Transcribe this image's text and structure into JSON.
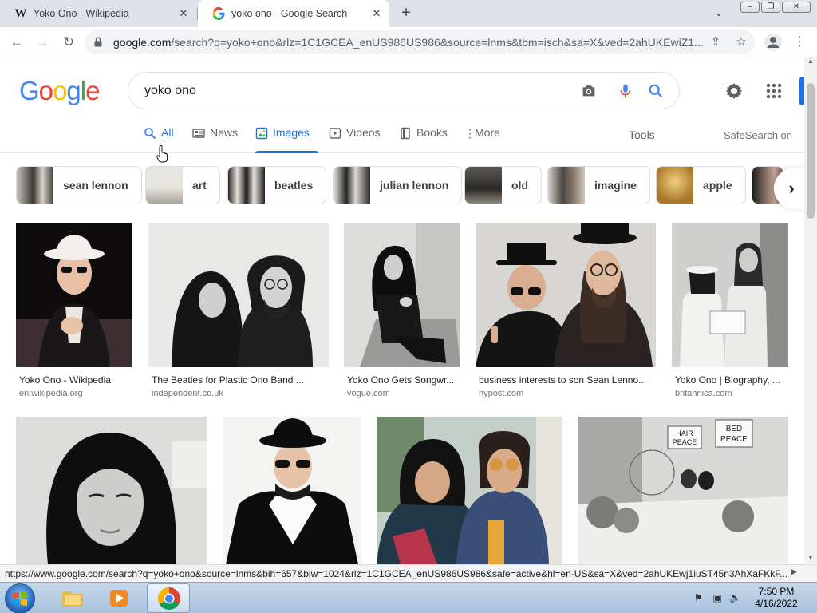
{
  "browser": {
    "tabs": [
      {
        "title": "Yoko Ono - Wikipedia",
        "favicon": "W"
      },
      {
        "title": "yoko ono - Google Search",
        "favicon": "google-g"
      }
    ],
    "url_host": "google.com",
    "url_path": "/search?q=yoko+ono&rlz=1C1GCEA_enUS986US986&source=lnms&tbm=isch&sa=X&ved=2ahUKEwiZ1..."
  },
  "google": {
    "logo": "Google",
    "query": "yoko ono",
    "nav": [
      {
        "label": "All",
        "icon": "search-icon",
        "active": false
      },
      {
        "label": "News",
        "icon": "news-icon",
        "active": false
      },
      {
        "label": "Images",
        "icon": "image-icon",
        "active": true
      },
      {
        "label": "Videos",
        "icon": "video-icon",
        "active": false
      },
      {
        "label": "Books",
        "icon": "book-icon",
        "active": false
      },
      {
        "label": "More",
        "icon": "more-vert-icon",
        "active": false
      }
    ],
    "tools": "Tools",
    "safesearch": "SafeSearch on",
    "chips": [
      "sean lennon",
      "art",
      "beatles",
      "julian lennon",
      "old",
      "imagine",
      "apple"
    ],
    "results": [
      {
        "title": "Yoko Ono - Wikipedia",
        "source": "en.wikipedia.org"
      },
      {
        "title": "The Beatles for Plastic Ono Band ...",
        "source": "independent.co.uk"
      },
      {
        "title": "Yoko Ono Gets Songwr...",
        "source": "vogue.com"
      },
      {
        "title": "business interests to son Sean Lenno...",
        "source": "nypost.com"
      },
      {
        "title": "Yoko Ono | Biography, ...",
        "source": "britannica.com"
      },
      {
        "title": "",
        "source": ""
      },
      {
        "title": "",
        "source": ""
      },
      {
        "title": "",
        "source": ""
      },
      {
        "title": "",
        "source": ""
      }
    ],
    "bed_peace_signs": [
      "HAIR PEACE",
      "BED PEACE"
    ]
  },
  "status_url": "https://www.google.com/search?q=yoko+ono&source=lnms&bih=657&biw=1024&rlz=1C1GCEA_enUS986US986&safe=active&hl=en-US&sa=X&ved=2ahUKEwj1iuST45n3AhXaFKkF...",
  "taskbar": {
    "time": "7:50 PM",
    "date": "4/16/2022"
  },
  "colors": {
    "accent": "#1a73e8",
    "google_blue": "#4285f4",
    "google_red": "#ea4335",
    "google_yellow": "#fbbc05",
    "google_green": "#34a853"
  }
}
